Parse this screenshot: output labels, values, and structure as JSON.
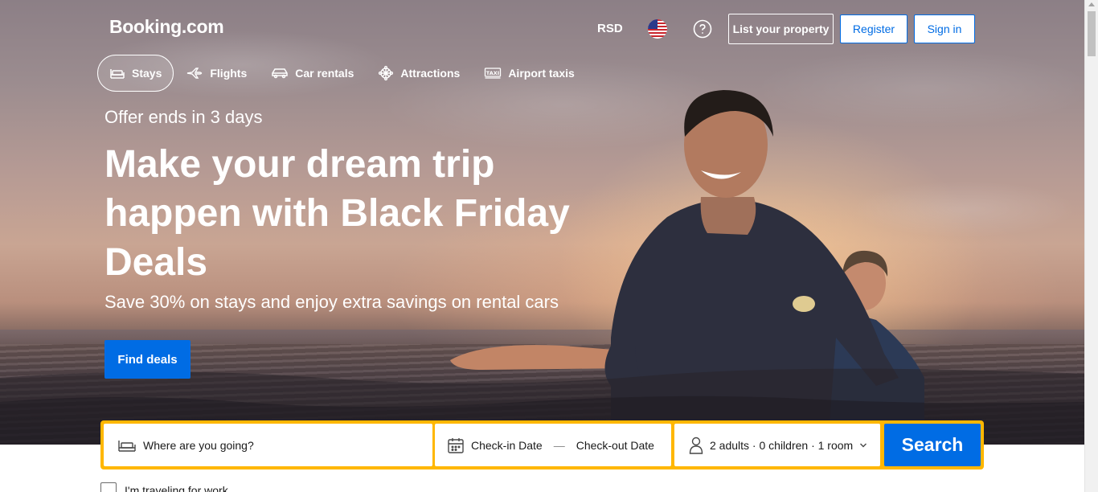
{
  "header": {
    "logo": "Booking.com",
    "currency": "RSD",
    "flag_icon": "us-flag-icon",
    "help_icon": "question-circle-icon",
    "list_property_label": "List your property",
    "register_label": "Register",
    "sign_in_label": "Sign in"
  },
  "nav": {
    "tabs": [
      {
        "label": "Stays",
        "icon": "bed-icon",
        "active": true
      },
      {
        "label": "Flights",
        "icon": "plane-icon",
        "active": false
      },
      {
        "label": "Car rentals",
        "icon": "car-icon",
        "active": false
      },
      {
        "label": "Attractions",
        "icon": "ferris-wheel-icon",
        "active": false
      },
      {
        "label": "Airport taxis",
        "icon": "taxi-icon",
        "active": false
      }
    ]
  },
  "hero": {
    "offer": "Offer ends in 3 days",
    "headline": "Make your dream trip happen with Black Friday Deals",
    "subheading": "Save 30% on stays and enjoy extra savings on rental cars",
    "cta_label": "Find deals"
  },
  "search": {
    "destination_placeholder": "Where are you going?",
    "checkin_label": "Check-in Date",
    "dash": "—",
    "checkout_label": "Check-out Date",
    "guests_label": "2 adults · 0 children · 1 room",
    "search_label": "Search"
  },
  "options": {
    "work_travel_label": "I'm traveling for work"
  },
  "colors": {
    "brand_blue": "#006ce4",
    "search_border": "#ffb700"
  }
}
